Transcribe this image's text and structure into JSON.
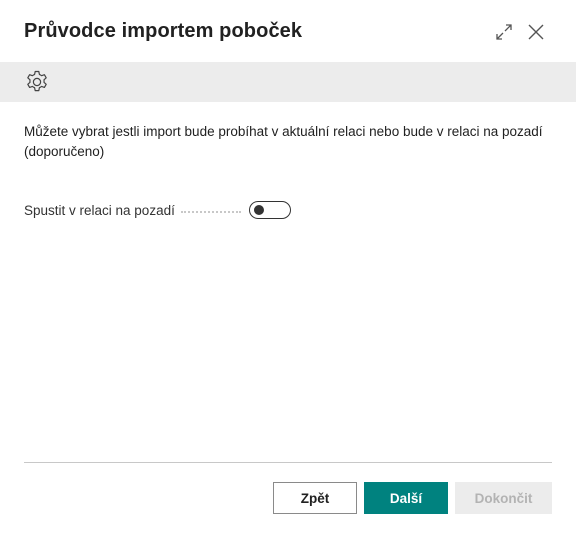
{
  "dialog": {
    "title": "Průvodce importem poboček",
    "icons": {
      "expand": "expand-icon",
      "close": "close-icon",
      "settings": "gear-icon"
    }
  },
  "main": {
    "instruction": "Můžete vybrat jestli import bude probíhat v aktuální relaci nebo bude v relaci na pozadí (doporučeno)",
    "background_session": {
      "label": "Spustit v relaci na pozadí",
      "enabled": false
    }
  },
  "footer": {
    "back_label": "Zpět",
    "next_label": "Další",
    "finish_label": "Dokončit"
  },
  "colors": {
    "accent": "#00827f",
    "toolbar_bg": "#ececec",
    "disabled_text": "#b3b3b3"
  }
}
